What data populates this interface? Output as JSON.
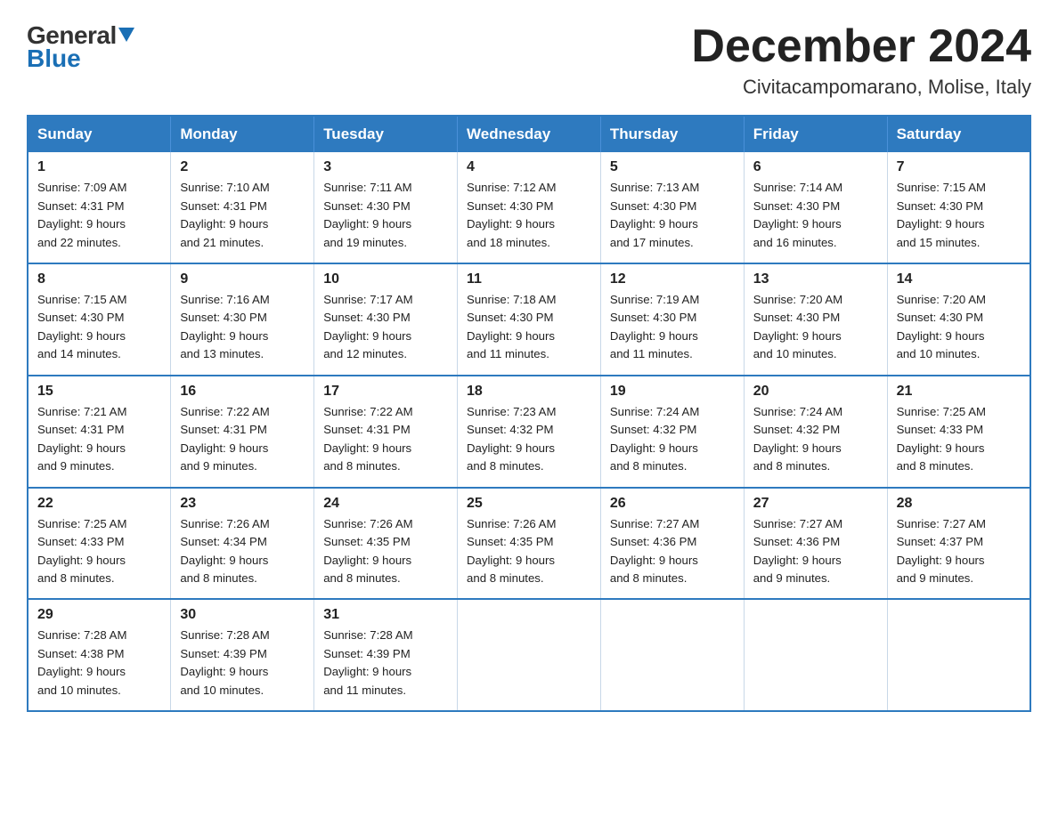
{
  "header": {
    "logo_general": "General",
    "logo_blue": "Blue",
    "title": "December 2024",
    "subtitle": "Civitacampomarano, Molise, Italy"
  },
  "days_of_week": [
    "Sunday",
    "Monday",
    "Tuesday",
    "Wednesday",
    "Thursday",
    "Friday",
    "Saturday"
  ],
  "weeks": [
    [
      {
        "day": "1",
        "sunrise": "7:09 AM",
        "sunset": "4:31 PM",
        "daylight": "9 hours and 22 minutes."
      },
      {
        "day": "2",
        "sunrise": "7:10 AM",
        "sunset": "4:31 PM",
        "daylight": "9 hours and 21 minutes."
      },
      {
        "day": "3",
        "sunrise": "7:11 AM",
        "sunset": "4:30 PM",
        "daylight": "9 hours and 19 minutes."
      },
      {
        "day": "4",
        "sunrise": "7:12 AM",
        "sunset": "4:30 PM",
        "daylight": "9 hours and 18 minutes."
      },
      {
        "day": "5",
        "sunrise": "7:13 AM",
        "sunset": "4:30 PM",
        "daylight": "9 hours and 17 minutes."
      },
      {
        "day": "6",
        "sunrise": "7:14 AM",
        "sunset": "4:30 PM",
        "daylight": "9 hours and 16 minutes."
      },
      {
        "day": "7",
        "sunrise": "7:15 AM",
        "sunset": "4:30 PM",
        "daylight": "9 hours and 15 minutes."
      }
    ],
    [
      {
        "day": "8",
        "sunrise": "7:15 AM",
        "sunset": "4:30 PM",
        "daylight": "9 hours and 14 minutes."
      },
      {
        "day": "9",
        "sunrise": "7:16 AM",
        "sunset": "4:30 PM",
        "daylight": "9 hours and 13 minutes."
      },
      {
        "day": "10",
        "sunrise": "7:17 AM",
        "sunset": "4:30 PM",
        "daylight": "9 hours and 12 minutes."
      },
      {
        "day": "11",
        "sunrise": "7:18 AM",
        "sunset": "4:30 PM",
        "daylight": "9 hours and 11 minutes."
      },
      {
        "day": "12",
        "sunrise": "7:19 AM",
        "sunset": "4:30 PM",
        "daylight": "9 hours and 11 minutes."
      },
      {
        "day": "13",
        "sunrise": "7:20 AM",
        "sunset": "4:30 PM",
        "daylight": "9 hours and 10 minutes."
      },
      {
        "day": "14",
        "sunrise": "7:20 AM",
        "sunset": "4:30 PM",
        "daylight": "9 hours and 10 minutes."
      }
    ],
    [
      {
        "day": "15",
        "sunrise": "7:21 AM",
        "sunset": "4:31 PM",
        "daylight": "9 hours and 9 minutes."
      },
      {
        "day": "16",
        "sunrise": "7:22 AM",
        "sunset": "4:31 PM",
        "daylight": "9 hours and 9 minutes."
      },
      {
        "day": "17",
        "sunrise": "7:22 AM",
        "sunset": "4:31 PM",
        "daylight": "9 hours and 8 minutes."
      },
      {
        "day": "18",
        "sunrise": "7:23 AM",
        "sunset": "4:32 PM",
        "daylight": "9 hours and 8 minutes."
      },
      {
        "day": "19",
        "sunrise": "7:24 AM",
        "sunset": "4:32 PM",
        "daylight": "9 hours and 8 minutes."
      },
      {
        "day": "20",
        "sunrise": "7:24 AM",
        "sunset": "4:32 PM",
        "daylight": "9 hours and 8 minutes."
      },
      {
        "day": "21",
        "sunrise": "7:25 AM",
        "sunset": "4:33 PM",
        "daylight": "9 hours and 8 minutes."
      }
    ],
    [
      {
        "day": "22",
        "sunrise": "7:25 AM",
        "sunset": "4:33 PM",
        "daylight": "9 hours and 8 minutes."
      },
      {
        "day": "23",
        "sunrise": "7:26 AM",
        "sunset": "4:34 PM",
        "daylight": "9 hours and 8 minutes."
      },
      {
        "day": "24",
        "sunrise": "7:26 AM",
        "sunset": "4:35 PM",
        "daylight": "9 hours and 8 minutes."
      },
      {
        "day": "25",
        "sunrise": "7:26 AM",
        "sunset": "4:35 PM",
        "daylight": "9 hours and 8 minutes."
      },
      {
        "day": "26",
        "sunrise": "7:27 AM",
        "sunset": "4:36 PM",
        "daylight": "9 hours and 8 minutes."
      },
      {
        "day": "27",
        "sunrise": "7:27 AM",
        "sunset": "4:36 PM",
        "daylight": "9 hours and 9 minutes."
      },
      {
        "day": "28",
        "sunrise": "7:27 AM",
        "sunset": "4:37 PM",
        "daylight": "9 hours and 9 minutes."
      }
    ],
    [
      {
        "day": "29",
        "sunrise": "7:28 AM",
        "sunset": "4:38 PM",
        "daylight": "9 hours and 10 minutes."
      },
      {
        "day": "30",
        "sunrise": "7:28 AM",
        "sunset": "4:39 PM",
        "daylight": "9 hours and 10 minutes."
      },
      {
        "day": "31",
        "sunrise": "7:28 AM",
        "sunset": "4:39 PM",
        "daylight": "9 hours and 11 minutes."
      },
      null,
      null,
      null,
      null
    ]
  ],
  "labels": {
    "sunrise": "Sunrise:",
    "sunset": "Sunset:",
    "daylight": "Daylight:"
  }
}
